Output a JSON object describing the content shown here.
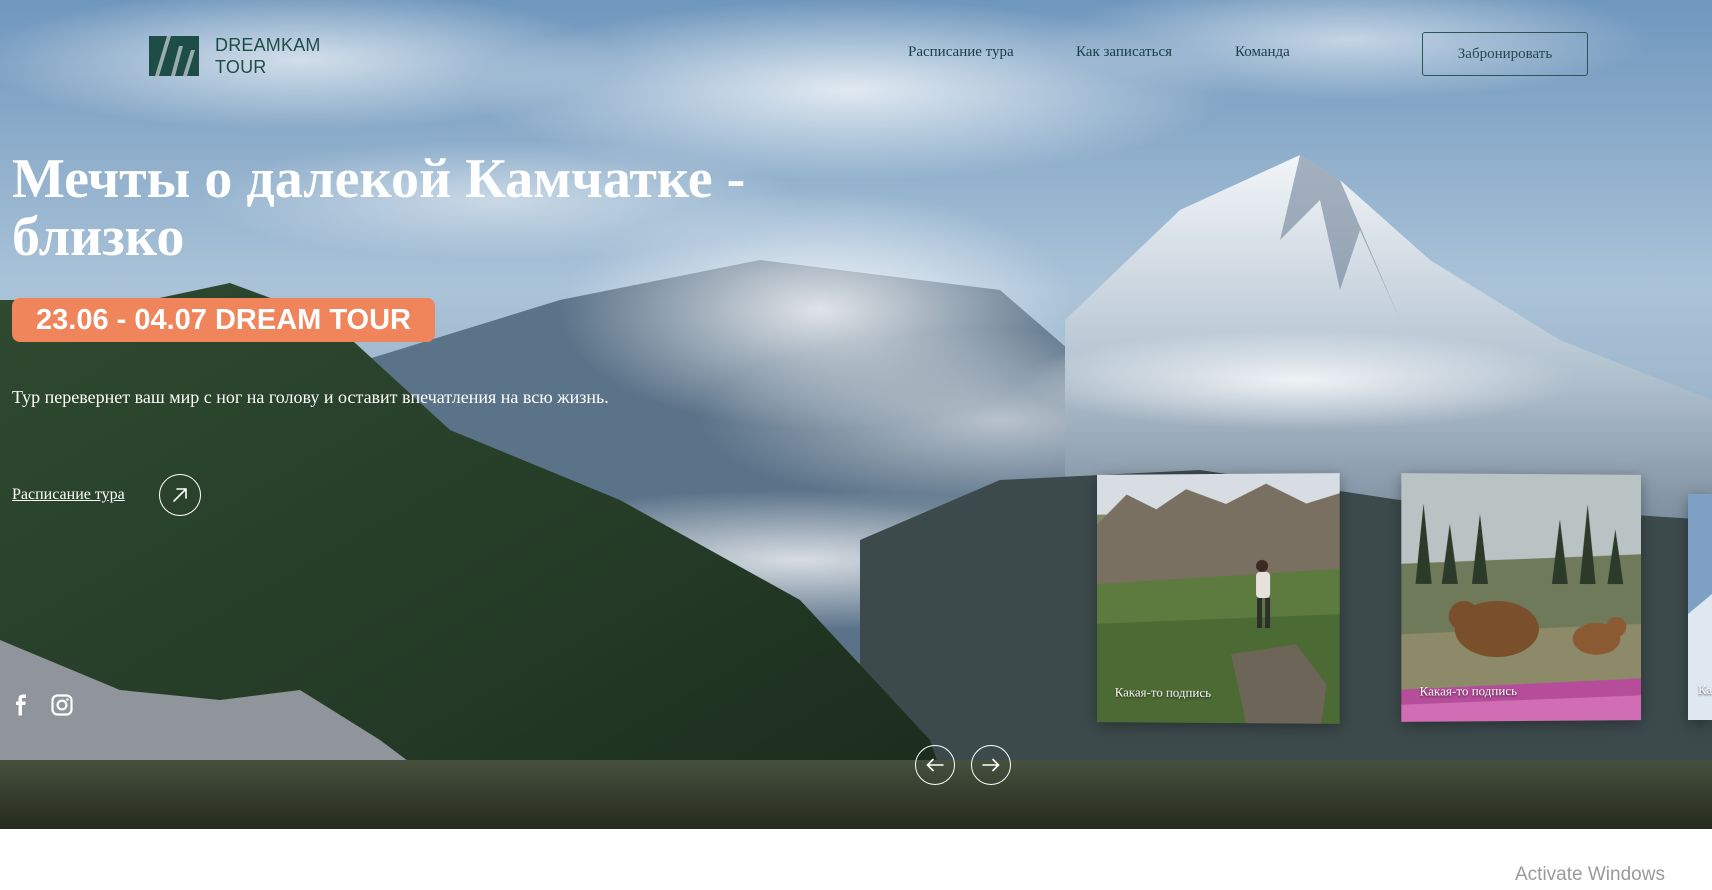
{
  "brand": {
    "line1": "DREAMKAM",
    "line2": "TOUR",
    "color": "#1e4d47"
  },
  "nav": {
    "items": [
      "Расписание тура",
      "Как записаться",
      "Команда"
    ],
    "book_label": "Забронировать"
  },
  "hero": {
    "title": "Мечты о далекой Камчатке - близко",
    "badge": "23.06 - 04.07 DREAM TOUR",
    "badge_color": "#f0845a",
    "subtitle": "Тур перевернет ваш мир с ног на голову и оставит впечатления на всю жизнь.",
    "schedule_link": "Расписание тура"
  },
  "social": {
    "icons": [
      "facebook-icon",
      "instagram-icon"
    ]
  },
  "carousel": {
    "cards": [
      {
        "caption": "Какая-то подпись",
        "image": "hiker-on-rock-photo"
      },
      {
        "caption": "Какая-то подпись",
        "image": "bears-photo"
      },
      {
        "caption": "Ка",
        "image": "snow-photo"
      }
    ],
    "prev_icon": "arrow-left-icon",
    "next_icon": "arrow-right-icon"
  },
  "watermark": "Activate Windows"
}
